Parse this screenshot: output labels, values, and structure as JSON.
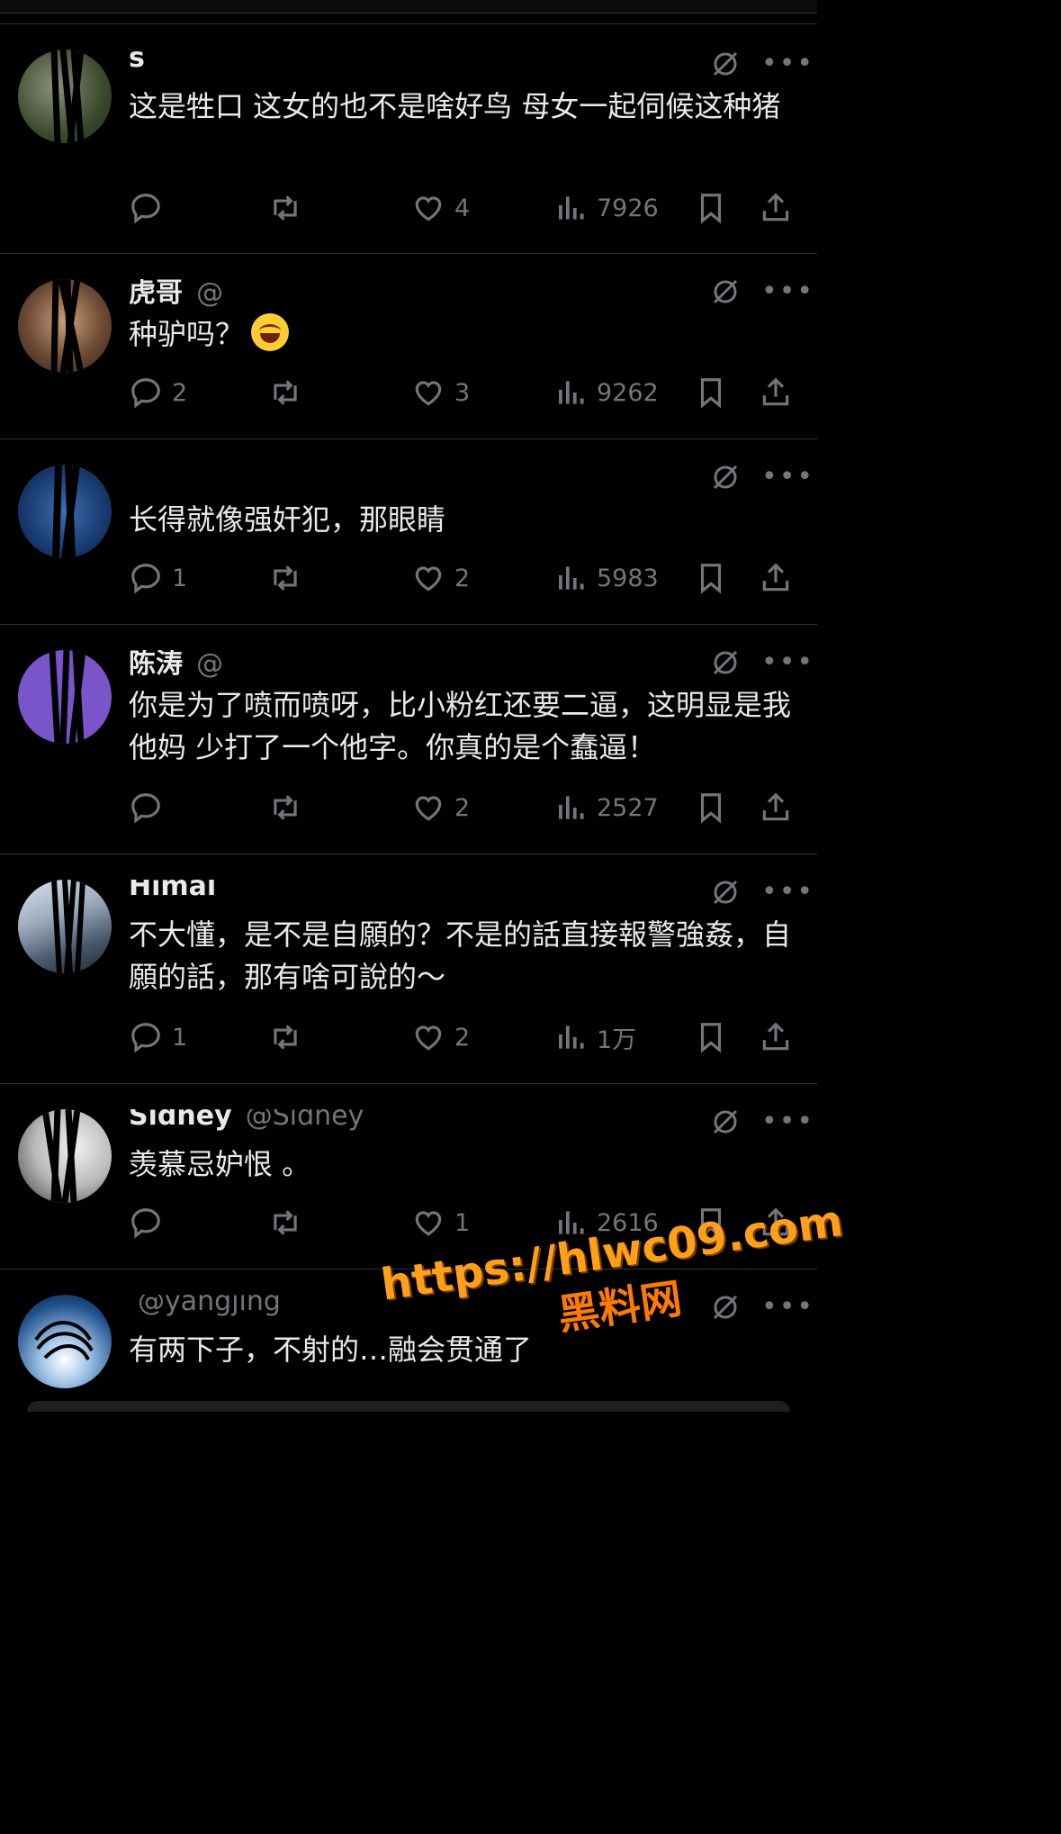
{
  "tweets": [
    {
      "name": "s",
      "handle": "",
      "text": "这是牲口 这女的也不是啥好鸟 母女一起伺候这种猪",
      "reply_count": "",
      "retweet_count": "",
      "like_count": "4",
      "view_count": "7926"
    },
    {
      "name": "虎哥",
      "handle": "@",
      "text": "种驴吗？",
      "has_emoji": true,
      "reply_count": "2",
      "retweet_count": "",
      "like_count": "3",
      "view_count": "9262"
    },
    {
      "name": "",
      "handle": "",
      "text": "长得就像强奸犯，那眼睛",
      "reply_count": "1",
      "retweet_count": "",
      "like_count": "2",
      "view_count": "5983"
    },
    {
      "name": "陈涛",
      "handle": "@",
      "text": "你是为了喷而喷呀，比小粉红还要二逼，这明显是我他妈 少打了一个他字。你真的是个蠢逼！",
      "reply_count": "",
      "retweet_count": "",
      "like_count": "2",
      "view_count": "2527"
    },
    {
      "name": "Himal",
      "handle": "",
      "text": "不大懂，是不是自願的？不是的話直接報警強姦，自願的話，那有啥可說的～",
      "reply_count": "1",
      "retweet_count": "",
      "like_count": "2",
      "view_count": "1万"
    },
    {
      "name": "Sidney",
      "handle": "@Sidney",
      "text": "羡慕忌妒恨 。",
      "reply_count": "",
      "retweet_count": "",
      "like_count": "1",
      "view_count": "2616"
    },
    {
      "name": "",
      "handle": "@yangjing",
      "text": "有两下子，不射的…融会贯通了",
      "reply_count": "",
      "retweet_count": "",
      "like_count": "",
      "view_count": ""
    }
  ],
  "watermark": {
    "url": "https://hlwc09.com",
    "label": "黑料网"
  },
  "icons": [
    "reply-icon",
    "retweet-icon",
    "like-icon",
    "views-icon",
    "bookmark-icon",
    "share-icon",
    "grok-icon",
    "more-icon"
  ],
  "colors": {
    "background": "#000000",
    "text": "#e7e9ea",
    "muted": "#71767b",
    "divider": "#2f3336",
    "watermark": "#ff9f1a"
  }
}
